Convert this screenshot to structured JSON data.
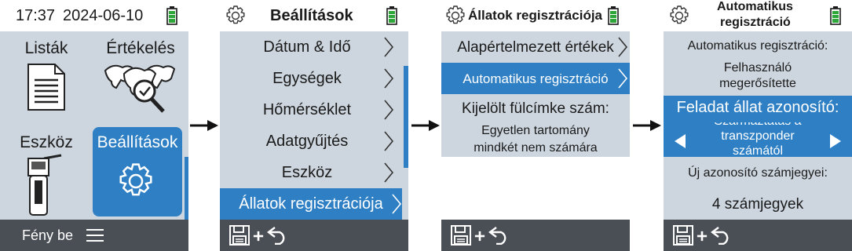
{
  "screen1": {
    "header": {
      "time": "17:37",
      "date": "2024-06-10"
    },
    "tiles": [
      {
        "label": "Listák",
        "icon": "list-document-icon"
      },
      {
        "label": "Értékelés",
        "icon": "cattle-evaluation-icon"
      },
      {
        "label": "Eszköz",
        "icon": "reader-device-icon"
      },
      {
        "label": "Beállítások",
        "icon": "gear-icon",
        "selected": true
      }
    ],
    "footer": {
      "light": "Fény be",
      "menu_icon": "hamburger-icon"
    }
  },
  "screen2": {
    "title": "Beállítások",
    "items": [
      {
        "label": "Dátum & Idő"
      },
      {
        "label": "Egységek"
      },
      {
        "label": "Hőmérséklet"
      },
      {
        "label": "Adatgyűjtés"
      },
      {
        "label": "Eszköz"
      },
      {
        "label": "Állatok regisztrációja",
        "selected": true
      }
    ]
  },
  "screen3": {
    "title": "Állatok regisztrációja",
    "items": [
      {
        "label": "Alapértelmezett értékek"
      },
      {
        "label": "Automatikus regisztráció",
        "selected": true
      }
    ],
    "info": {
      "label": "Kijelölt fülcímke szám:",
      "value_line1": "Egyetlen tartomány",
      "value_line2": "mindkét nem számára"
    }
  },
  "screen4": {
    "title_line1": "Automatikus",
    "title_line2": "regisztráció",
    "auto_label": "Automatikus regisztráció:",
    "auto_value_line1": "Felhasználó",
    "auto_value_line2": "megerősítette",
    "task_label": "Feladat állat azonosító:",
    "task_value_line1": "Származtatás a",
    "task_value_line2": "transzponder",
    "task_value_line3": "számától",
    "digits_label": "Új azonosító számjegyei:",
    "digits_value": "4 számjegyek"
  },
  "footer_icons": [
    "save-icon",
    "plus-icon",
    "return-arrow-icon"
  ],
  "colors": {
    "accent": "#2e7fc4",
    "panel": "#cdd6df",
    "footer": "#4a4e55",
    "battery": "#2fa63a"
  }
}
